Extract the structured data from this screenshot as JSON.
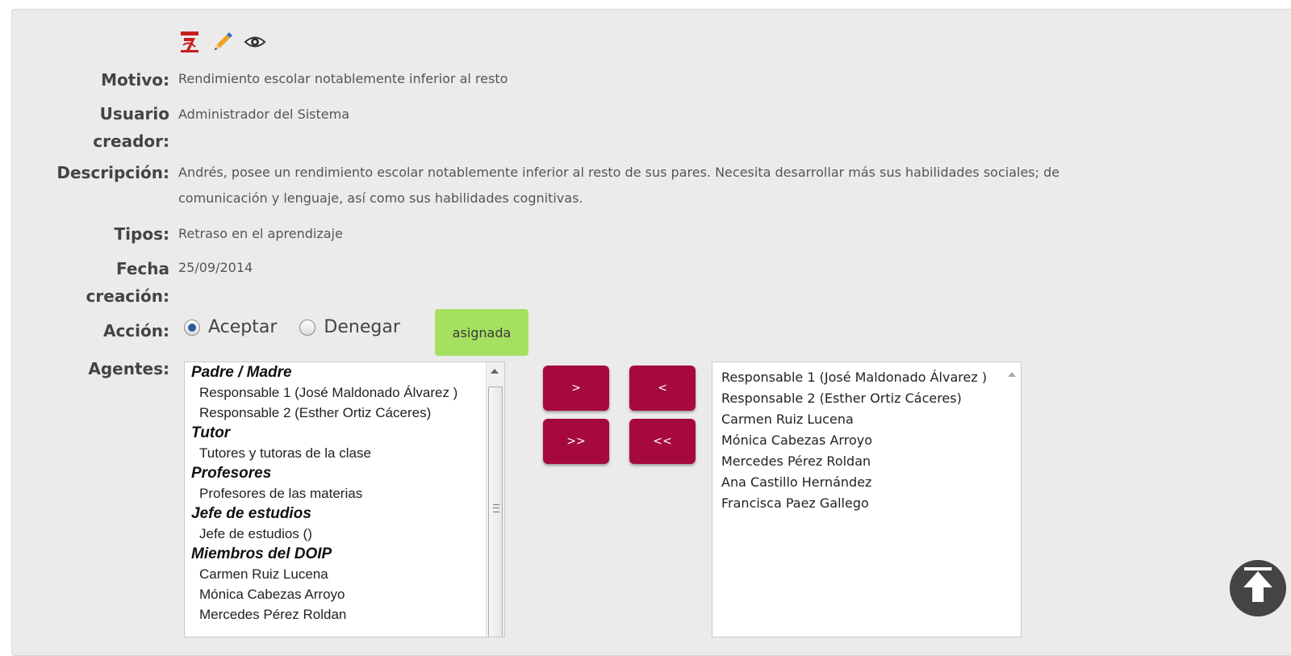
{
  "fields": {
    "motivo": {
      "label": "Motivo:",
      "value": "Rendimiento escolar notablemente inferior al resto"
    },
    "usuario": {
      "label": "Usuario\ncreador:",
      "value": "Administrador del Sistema"
    },
    "descripcion": {
      "label": "Descripción:",
      "value": "Andrés, posee un rendimiento escolar notablemente inferior al resto de sus pares. Necesita desarrollar más sus habilidades sociales; de\ncomunicación y lenguaje, así como sus habilidades cognitivas."
    },
    "tipos": {
      "label": "Tipos:",
      "value": "Retraso en el aprendizaje"
    },
    "fecha": {
      "label": "Fecha\ncreación:",
      "value": "25/09/2014"
    },
    "accion": {
      "label": "Acción:"
    },
    "agentes": {
      "label": "Agentes:"
    }
  },
  "accion": {
    "options": [
      {
        "label": "Aceptar",
        "checked": true
      },
      {
        "label": "Denegar",
        "checked": false
      }
    ],
    "badge": "asignada",
    "badge_color": "#a6e060"
  },
  "available_agents": {
    "groups": [
      {
        "label": "Padre / Madre",
        "items": [
          "Responsable 1 (José Maldonado Álvarez )",
          "Responsable 2 (Esther Ortiz Cáceres)"
        ]
      },
      {
        "label": "Tutor",
        "items": [
          "Tutores y tutoras de la clase"
        ]
      },
      {
        "label": "Profesores",
        "items": [
          "Profesores de las materias"
        ]
      },
      {
        "label": "Jefe de estudios",
        "items": [
          "Jefe de estudios ()"
        ]
      },
      {
        "label": "Miembros del DOIP",
        "items": [
          "Carmen Ruiz Lucena",
          "Mónica Cabezas Arroyo",
          "Mercedes Pérez Roldan"
        ]
      }
    ]
  },
  "selected_agents": [
    "Responsable 1 (José Maldonado Álvarez )",
    "Responsable 2 (Esther Ortiz Cáceres)",
    "Carmen Ruiz Lucena",
    "Mónica Cabezas Arroyo",
    "Mercedes Pérez Roldan",
    "Ana Castillo Hernández",
    "Francisca Paez Gallego"
  ],
  "buttons": {
    "move_right": ">",
    "move_left": "<",
    "move_all_right": ">>",
    "move_all_left": "<<",
    "color": "#a60a3d"
  },
  "icons": [
    "pdf-icon",
    "edit-pencil-icon",
    "view-eye-icon",
    "scroll-to-top-icon"
  ]
}
